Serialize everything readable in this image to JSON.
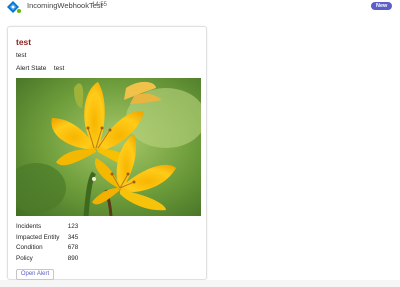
{
  "message": {
    "sender": "IncomingWebhookTest",
    "time": "14:55",
    "badge": "New"
  },
  "card": {
    "title": "test",
    "subtitle": "test",
    "alert_state": {
      "label": "Alert State",
      "value": "test"
    },
    "image": {
      "alt": "yellow-lily-flower"
    },
    "facts": [
      {
        "label": "Incidents",
        "value": "123"
      },
      {
        "label": "Impacted Entity",
        "value": "345"
      },
      {
        "label": "Condition",
        "value": "678"
      },
      {
        "label": "Policy",
        "value": "890"
      }
    ],
    "action_label": "Open Alert"
  },
  "colors": {
    "accent": "#5b5fc7",
    "title": "#8a1f1f",
    "status_available": "#6bb700"
  }
}
